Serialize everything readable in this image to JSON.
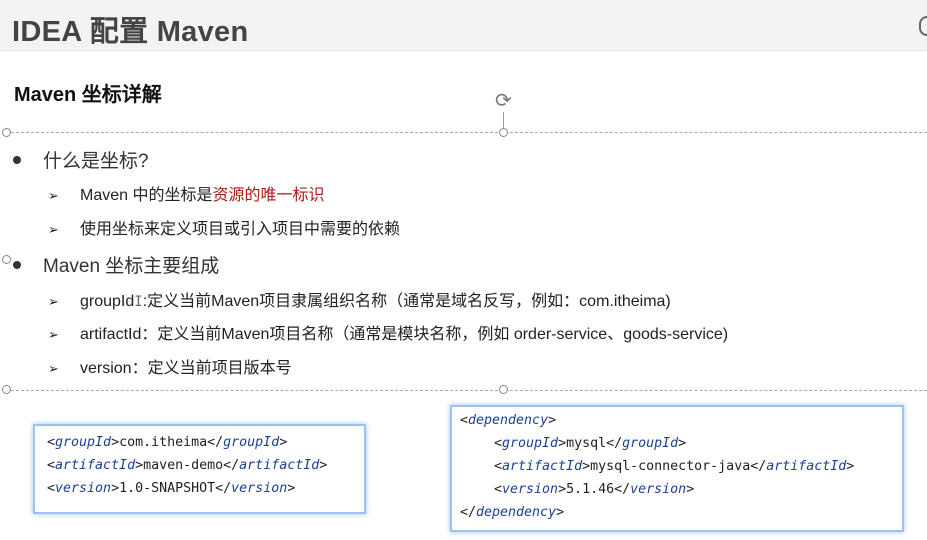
{
  "slide": {
    "title": "IDEA 配置 Maven"
  },
  "section": {
    "title": "Maven 坐标详解"
  },
  "bullets": [
    {
      "text": "什么是坐标?",
      "items": [
        {
          "prefix": "Maven 中的坐标是",
          "highlight": "资源的唯一标识",
          "suffix": ""
        },
        {
          "prefix": "使用坐标来定义项目或引入项目中需要的依赖",
          "highlight": "",
          "suffix": ""
        }
      ]
    },
    {
      "text": "Maven 坐标主要组成",
      "items": [
        {
          "prefix": "groupId",
          "cursor": "I",
          "suffix": ":定义当前Maven项目隶属组织名称（通常是域名反写，例如：com.itheima)"
        },
        {
          "prefix": "artifactId：定义当前Maven项目名称（通常是模块名称，例如 order-service、goods-service)"
        },
        {
          "prefix": "version：定义当前项目版本号"
        }
      ]
    }
  ],
  "bullet_marker": "➢",
  "code_left": {
    "lines": [
      {
        "open": "groupId",
        "value": "com.itheima",
        "close": "groupId"
      },
      {
        "open": "artifactId",
        "value": "maven-demo",
        "close": "artifactId"
      },
      {
        "open": "version",
        "value": "1.0-SNAPSHOT",
        "close": "version"
      }
    ]
  },
  "code_right": {
    "outer_open": "dependency",
    "lines": [
      {
        "open": "groupId",
        "value": "mysql",
        "close": "groupId"
      },
      {
        "open": "artifactId",
        "value": "mysql-connector-java",
        "close": "artifactId"
      },
      {
        "open": "version",
        "value": "5.1.46",
        "close": "version"
      }
    ],
    "outer_close": "dependency"
  },
  "colors": {
    "highlight": "#b01818",
    "tag": "#1d3f93",
    "code_border": "#9ec2f0"
  },
  "icons": {
    "rotate": "rotate-icon"
  }
}
